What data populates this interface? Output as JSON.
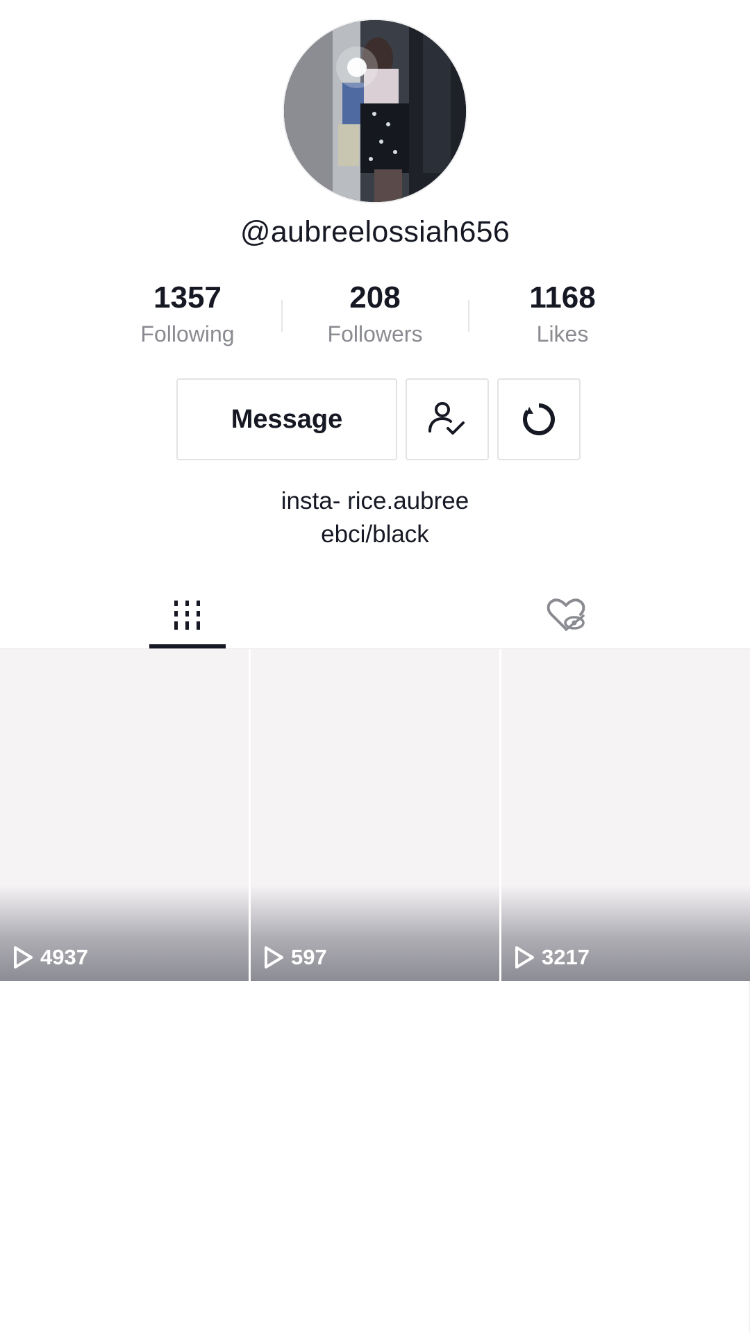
{
  "profile": {
    "username": "@aubreelossiah656",
    "bio_line1": "insta- rice.aubree",
    "bio_line2": "ebci/black"
  },
  "stats": {
    "following_count": "1357",
    "following_label": "Following",
    "followers_count": "208",
    "followers_label": "Followers",
    "likes_count": "1168",
    "likes_label": "Likes"
  },
  "actions": {
    "message_label": "Message",
    "following_icon": "user-check-icon",
    "suggest_icon": "refresh-icon"
  },
  "tabs": {
    "videos_icon": "grid-icon",
    "liked_icon": "hidden-heart-icon",
    "active": "videos"
  },
  "videos": [
    {
      "views": "4937"
    },
    {
      "views": "597"
    },
    {
      "views": "3217"
    }
  ],
  "colors": {
    "text_primary": "#161823",
    "text_secondary": "#8a8b91",
    "border": "#e3e3e6",
    "tile_bg": "#f6f3f5"
  }
}
